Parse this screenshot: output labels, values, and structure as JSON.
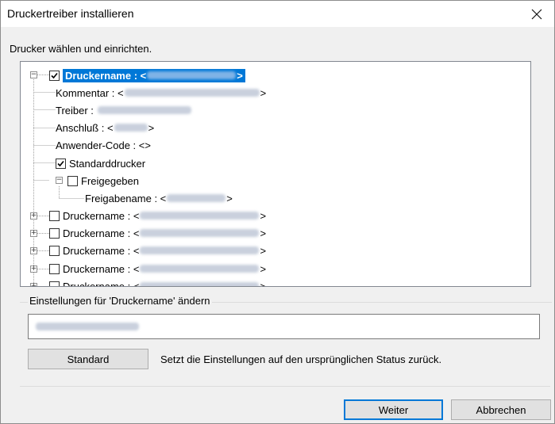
{
  "window": {
    "title": "Druckertreiber installieren"
  },
  "subtitle": "Drucker wählen und einrichten.",
  "tree": {
    "root": {
      "prefix": "Druckername : <",
      "suffix": ">"
    },
    "kommentar": {
      "prefix": "Kommentar : <",
      "suffix": ">"
    },
    "treiber": {
      "prefix": "Treiber :"
    },
    "anschluss": {
      "prefix": "Anschluß : <",
      "suffix": ">"
    },
    "anwender": {
      "label": "Anwender-Code : <>"
    },
    "standard": {
      "label": "Standarddrucker",
      "checked": true
    },
    "freigegeben": {
      "label": "Freigegeben",
      "checked": false
    },
    "freigabename": {
      "prefix": "Freigabename : <",
      "suffix": ">"
    },
    "others": [
      {
        "prefix": "Druckername : <",
        "suffix": ">"
      },
      {
        "prefix": "Druckername : <",
        "suffix": ">"
      },
      {
        "prefix": "Druckername : <",
        "suffix": ">"
      },
      {
        "prefix": "Druckername : <",
        "suffix": ">"
      },
      {
        "prefix": "Druckername : <",
        "suffix": ">"
      }
    ]
  },
  "settings": {
    "label": "Einstellungen für 'Druckername' ändern",
    "standard_button": "Standard",
    "reset_text": "Setzt die Einstellungen auf den ursprünglichen Status zurück."
  },
  "buttons": {
    "weiter": "Weiter",
    "abbrechen": "Abbrechen"
  },
  "colors": {
    "selection": "#0078d7",
    "background": "#f0f0f0"
  }
}
